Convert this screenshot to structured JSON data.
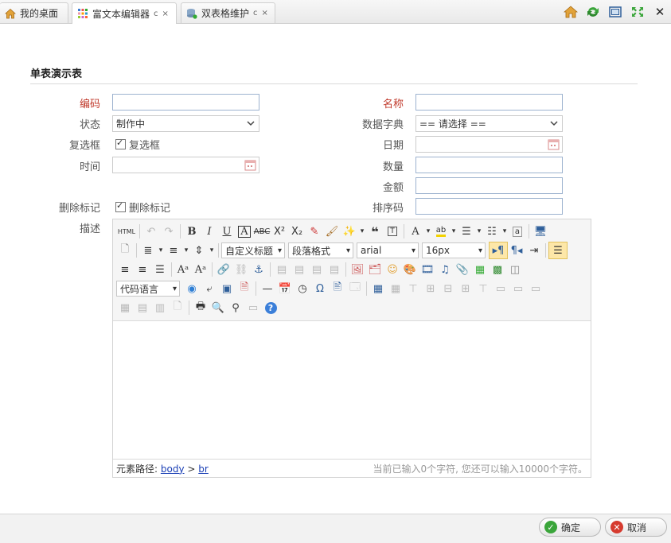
{
  "tabs": [
    {
      "label": "我的桌面"
    },
    {
      "label": "富文本编辑器",
      "refresh": "c",
      "close": "×"
    },
    {
      "label": "双表格维护",
      "refresh": "c",
      "close": "×"
    }
  ],
  "top_close": "✕",
  "form": {
    "title": "单表演示表",
    "fields": {
      "code_label": "编码",
      "name_label": "名称",
      "status_label": "状态",
      "status_value": "制作中",
      "dict_label": "数据字典",
      "dict_value": "== 请选择 ==",
      "checkbox_label": "复选框",
      "checkbox_text": "复选框",
      "date_label": "日期",
      "time_label": "时间",
      "qty_label": "数量",
      "amount_label": "金额",
      "delete_label": "删除标记",
      "delete_text": "删除标记",
      "sort_label": "排序码",
      "desc_label": "描述"
    }
  },
  "editor": {
    "html_btn": "HTML",
    "custom_title": "自定义标题",
    "paragraph": "段落格式",
    "font": "arial",
    "size": "16px",
    "code_lang": "代码语言",
    "path_label": "元素路径:",
    "path_body": "body",
    "path_sep": ">",
    "path_br": "br",
    "count": "当前已输入0个字符, 您还可以输入10000个字符。"
  },
  "footer": {
    "ok": "确定",
    "cancel": "取消"
  },
  "colors": {
    "accent": "#1a3fb5",
    "required": "#c0392b",
    "ok_green": "#3aa53a",
    "cancel_red": "#d63b2f"
  }
}
